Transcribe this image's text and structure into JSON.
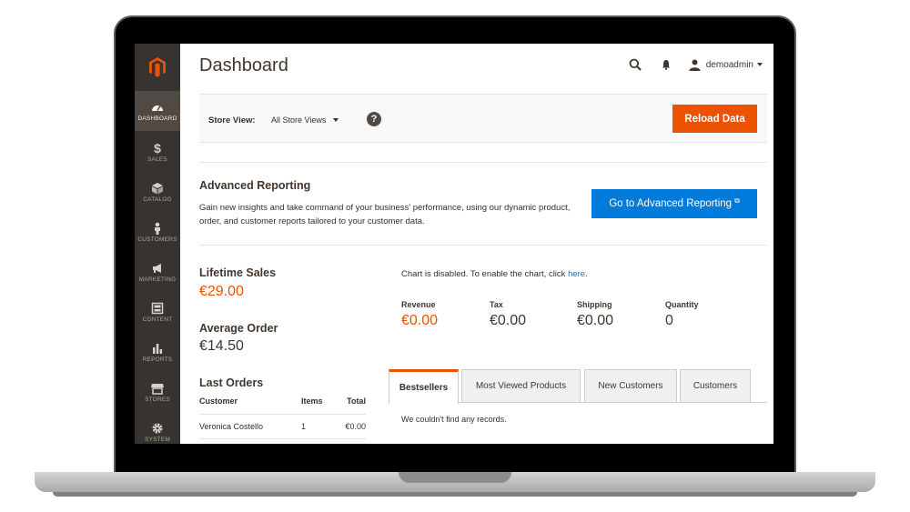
{
  "sidebar": {
    "items": [
      {
        "label": "DASHBOARD",
        "icon": "dashboard-icon",
        "active": true
      },
      {
        "label": "SALES",
        "icon": "dollar-icon"
      },
      {
        "label": "CATALOG",
        "icon": "cube-icon"
      },
      {
        "label": "CUSTOMERS",
        "icon": "person-icon"
      },
      {
        "label": "MARKETING",
        "icon": "megaphone-icon"
      },
      {
        "label": "CONTENT",
        "icon": "content-icon"
      },
      {
        "label": "REPORTS",
        "icon": "bar-chart-icon"
      },
      {
        "label": "STORES",
        "icon": "storefront-icon"
      },
      {
        "label": "SYSTEM",
        "icon": "gear-icon"
      }
    ]
  },
  "header": {
    "title": "Dashboard",
    "username": "demoadmin"
  },
  "store_bar": {
    "label": "Store View:",
    "selected": "All Store Views",
    "help": "?",
    "reload_label": "Reload Data"
  },
  "advanced": {
    "title": "Advanced Reporting",
    "description": "Gain new insights and take command of your business' performance, using our dynamic product, order, and customer reports tailored to your customer data.",
    "button_label": "Go to Advanced Reporting",
    "ext_glyph": "⧉"
  },
  "stats": {
    "lifetime_label": "Lifetime Sales",
    "lifetime_value": "€29.00",
    "average_label": "Average Order",
    "average_value": "€14.50"
  },
  "chart": {
    "message": "Chart is disabled. To enable the chart, click",
    "link": "here",
    "period": "."
  },
  "kpis": [
    {
      "label": "Revenue",
      "value": "€0.00"
    },
    {
      "label": "Tax",
      "value": "€0.00"
    },
    {
      "label": "Shipping",
      "value": "€0.00"
    },
    {
      "label": "Quantity",
      "value": "0"
    }
  ],
  "last_orders": {
    "title": "Last Orders",
    "columns": [
      "Customer",
      "Items",
      "Total"
    ],
    "rows": [
      {
        "customer": "Veronica Costello",
        "items": "1",
        "total": "€0.00"
      }
    ]
  },
  "tabs": [
    {
      "label": "Bestsellers",
      "active": true
    },
    {
      "label": "Most Viewed Products"
    },
    {
      "label": "New Customers"
    },
    {
      "label": "Customers"
    }
  ],
  "tab_content": {
    "empty_message": "We couldn't find any records."
  },
  "colors": {
    "accent_orange": "#eb5202",
    "link_blue": "#007bdb",
    "sidebar_bg": "#373330"
  }
}
